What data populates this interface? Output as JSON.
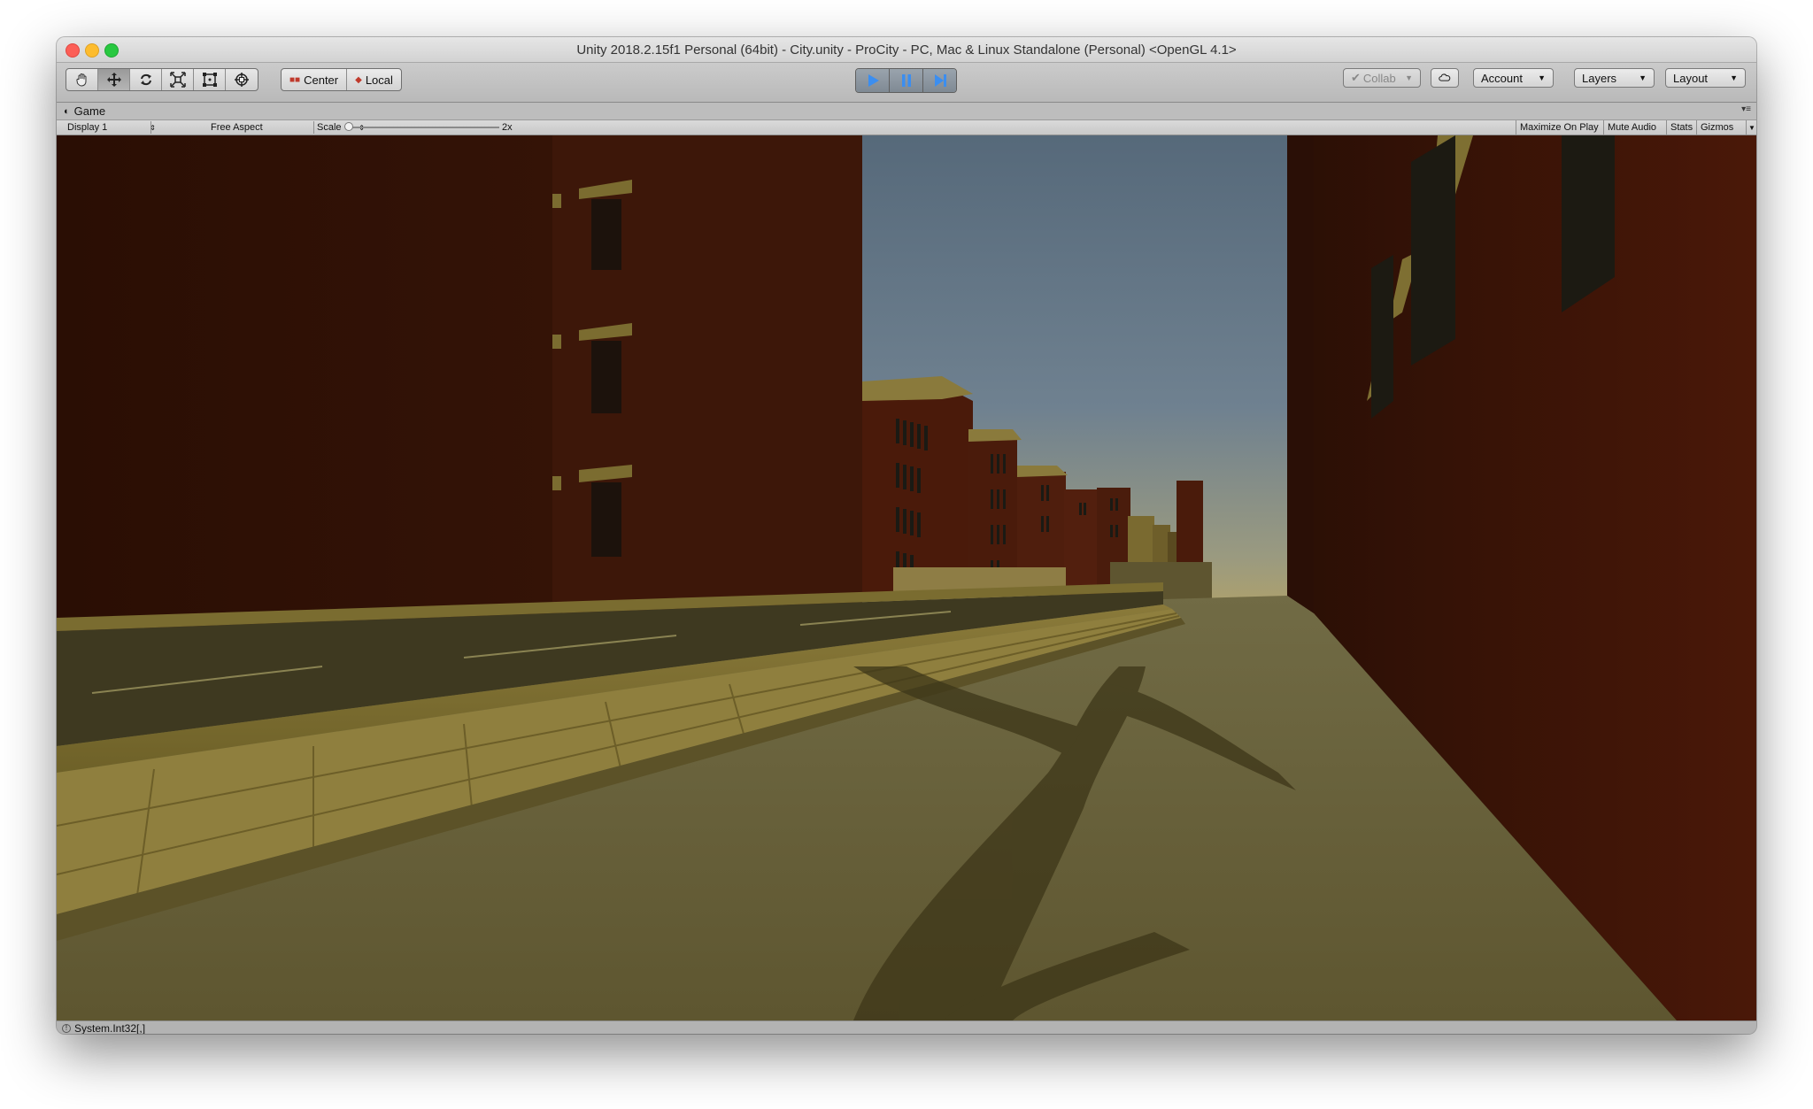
{
  "window": {
    "title": "Unity 2018.2.15f1 Personal (64bit) - City.unity - ProCity - PC, Mac & Linux Standalone (Personal) <OpenGL 4.1>"
  },
  "toolbar": {
    "tools": [
      "hand-tool",
      "move-tool",
      "rotate-tool",
      "scale-tool",
      "rect-tool",
      "transform-tool"
    ],
    "active_tool": "move-tool",
    "pivot_mode": "Center",
    "pivot_space": "Local",
    "playback": {
      "play": "play",
      "pause": "pause",
      "step": "step"
    },
    "collab": "Collab",
    "account": "Account",
    "layers": "Layers",
    "layout": "Layout",
    "accent": "#3b8ef0"
  },
  "game_tab": {
    "label": "Game"
  },
  "game_bar": {
    "display": "Display 1",
    "aspect": "Free Aspect",
    "scale_label": "Scale",
    "scale_value": "2x",
    "scale_level": 0.0,
    "maximize": "Maximize On Play",
    "mute": "Mute Audio",
    "stats": "Stats",
    "gizmos": "Gizmos"
  },
  "status_bar": {
    "message": "System.Int32[,]"
  },
  "scene": {
    "sky_top": "#5a6e80",
    "sky_bottom": "#a79f72",
    "brick": "#3d1608",
    "sidewalk": "#6a6030",
    "road": "#3a3520"
  }
}
